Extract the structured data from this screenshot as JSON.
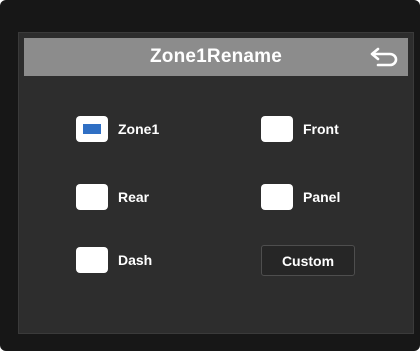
{
  "dialog": {
    "title": "Zone1Rename",
    "back_icon": "undo-arrow-icon"
  },
  "options": [
    {
      "label": "Zone1",
      "checked": true
    },
    {
      "label": "Front",
      "checked": false
    },
    {
      "label": "Rear",
      "checked": false
    },
    {
      "label": "Panel",
      "checked": false
    },
    {
      "label": "Dash",
      "checked": false
    }
  ],
  "custom_button": {
    "label": "Custom"
  },
  "colors": {
    "bezel": "#171717",
    "screen": "#2d2d2d",
    "titlebar": "#8c8c8c",
    "checked_mark": "#2f6fc4"
  }
}
